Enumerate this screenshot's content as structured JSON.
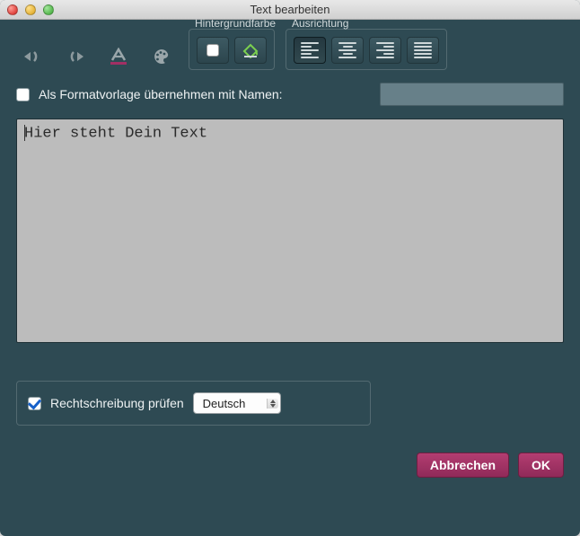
{
  "window": {
    "title": "Text bearbeiten"
  },
  "toolbar": {
    "bg_group_label": "Hintergrundfarbe",
    "align_group_label": "Ausrichtung"
  },
  "template": {
    "checked": false,
    "label": "Als Formatvorlage übernehmen mit Namen:",
    "value": ""
  },
  "editor": {
    "text": "Hier steht Dein Text"
  },
  "spellcheck": {
    "checked": true,
    "label": "Rechtschreibung prüfen",
    "language": "Deutsch"
  },
  "buttons": {
    "cancel": "Abbrechen",
    "ok": "OK"
  }
}
